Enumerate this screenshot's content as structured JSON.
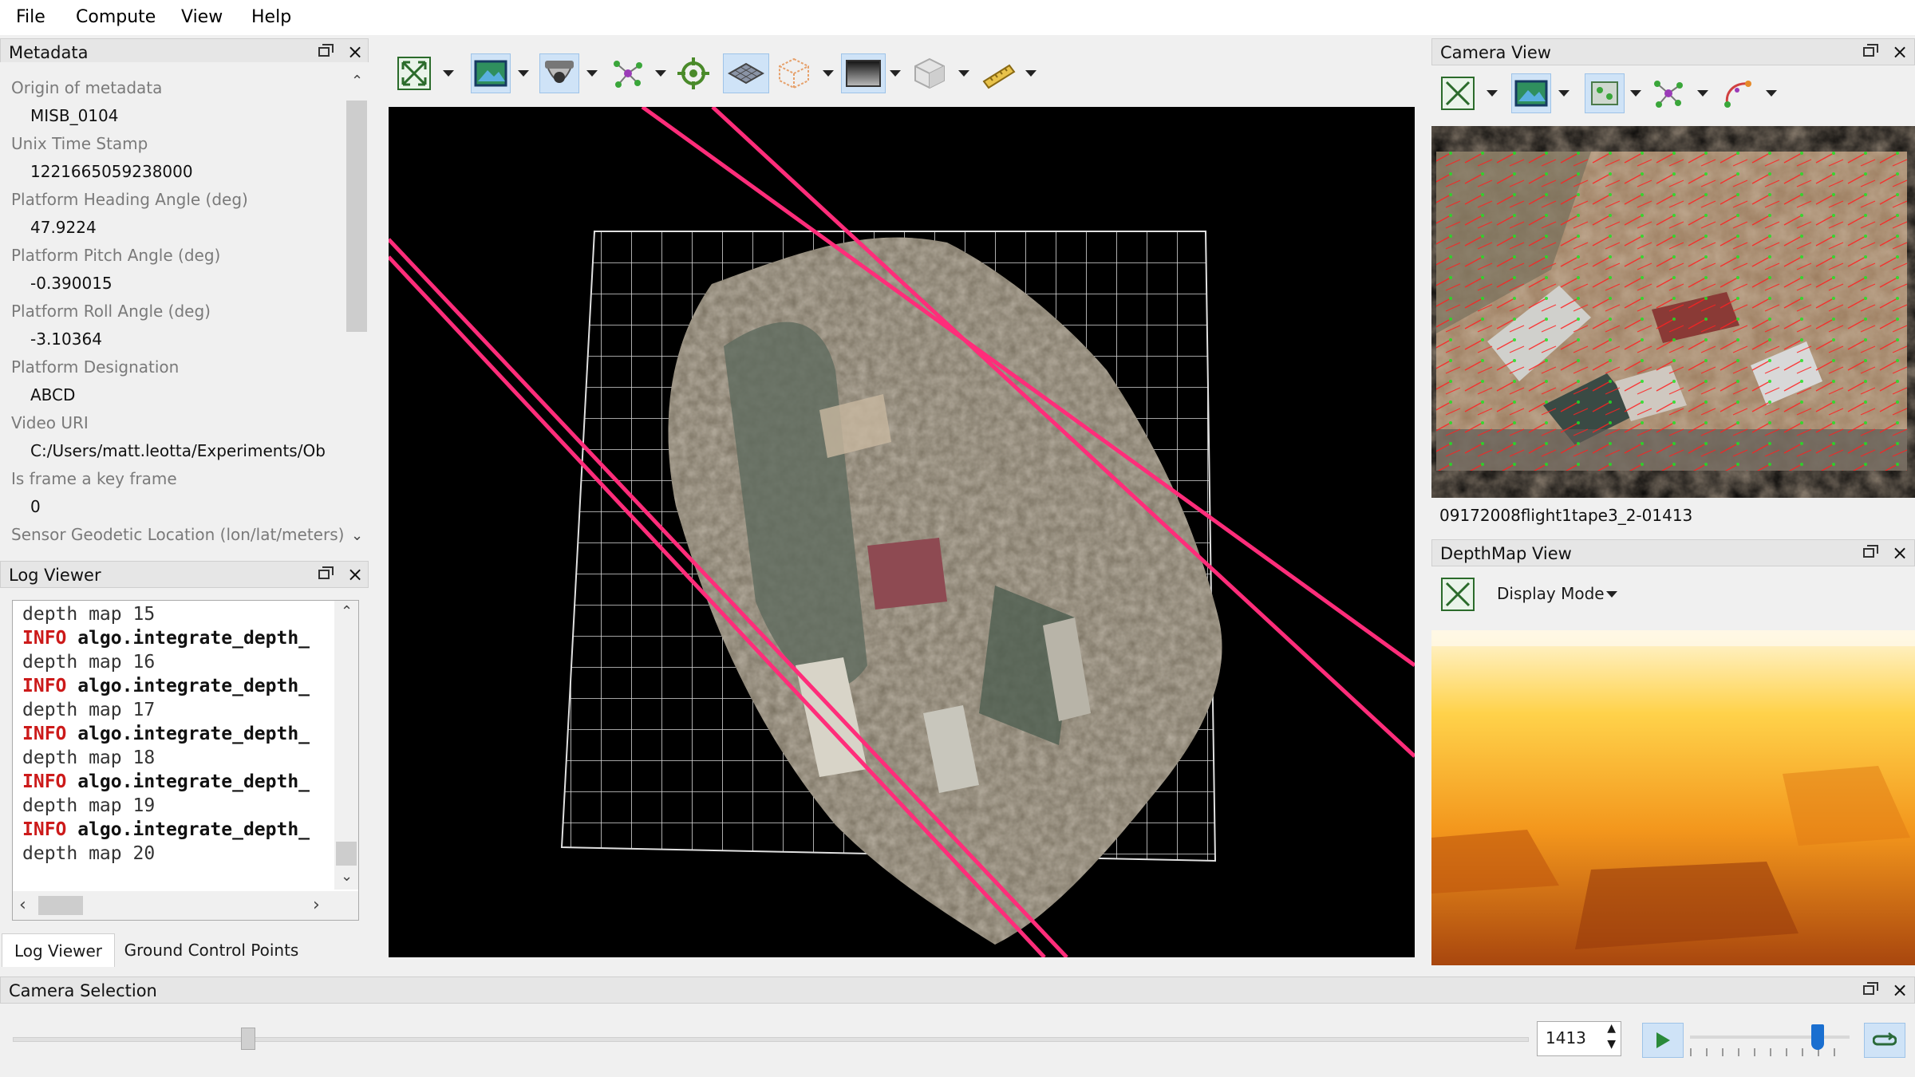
{
  "menubar": {
    "items": [
      "File",
      "Compute",
      "View",
      "Help"
    ]
  },
  "metadata": {
    "title": "Metadata",
    "fields": [
      {
        "key": "Origin of metadata",
        "value": "MISB_0104"
      },
      {
        "key": "Unix Time Stamp",
        "value": "1221665059238000"
      },
      {
        "key": "Platform Heading Angle (deg)",
        "value": "47.9224"
      },
      {
        "key": "Platform Pitch Angle (deg)",
        "value": "-0.390015"
      },
      {
        "key": "Platform Roll Angle (deg)",
        "value": "-3.10364"
      },
      {
        "key": "Platform Designation",
        "value": "ABCD"
      },
      {
        "key": "Video URI",
        "value": "C:/Users/matt.leotta/Experiments/Obstac"
      },
      {
        "key": "Is frame a key frame",
        "value": "0"
      },
      {
        "key": "Sensor Geodetic Location (lon/lat/meters)",
        "value": ""
      }
    ]
  },
  "log": {
    "title": "Log Viewer",
    "lines": [
      {
        "prefix": "",
        "text": "depth map 15"
      },
      {
        "prefix": "INFO",
        "text": " algo.integrate_depth_"
      },
      {
        "prefix": "",
        "text": "depth map 16"
      },
      {
        "prefix": "INFO",
        "text": " algo.integrate_depth_"
      },
      {
        "prefix": "",
        "text": "depth map 17"
      },
      {
        "prefix": "INFO",
        "text": " algo.integrate_depth_"
      },
      {
        "prefix": "",
        "text": "depth map 18"
      },
      {
        "prefix": "INFO",
        "text": " algo.integrate_depth_"
      },
      {
        "prefix": "",
        "text": "depth map 19"
      },
      {
        "prefix": "INFO",
        "text": " algo.integrate_depth_"
      },
      {
        "prefix": "",
        "text": "depth map 20"
      }
    ]
  },
  "tabs": [
    {
      "label": "Log Viewer",
      "active": true
    },
    {
      "label": "Ground Control Points",
      "active": false
    }
  ],
  "camera_view": {
    "title": "Camera View",
    "frame_label": "09172008flight1tape3_2-01413"
  },
  "depthmap_view": {
    "title": "DepthMap View",
    "display_mode_label": "Display Mode"
  },
  "camera_selection": {
    "title": "Camera Selection",
    "frame_value": "1413",
    "slider_fraction": 0.155,
    "speed_fraction": 0.8
  },
  "colors": {
    "accent": "#cfe3f7",
    "camera_path": "#ff2d7a",
    "log_info": "#cc1a1a"
  },
  "icons": {
    "reset_view": "reset-view-icon",
    "imagery": "world-imagery-icon",
    "camera": "camera-frustum-icon",
    "landmarks": "landmarks-icon",
    "target": "target-icon",
    "ground_plane": "ground-plane-icon",
    "roi": "roi-box-icon",
    "depth": "depth-map-icon",
    "mesh": "mesh-icon",
    "measure": "measure-icon"
  }
}
